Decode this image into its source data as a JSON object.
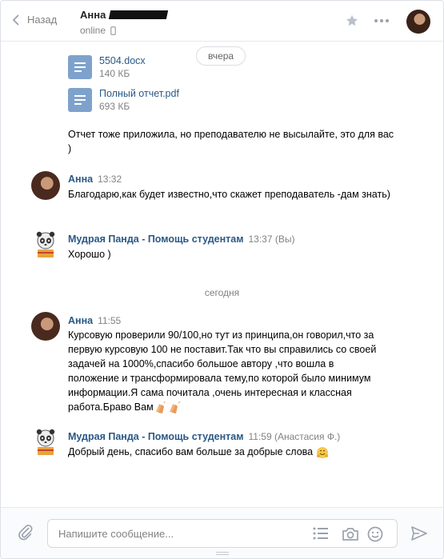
{
  "header": {
    "back_label": "Назад",
    "peer_name": "Анна",
    "peer_status": "online"
  },
  "chat": {
    "date_pill": "вчера",
    "files": [
      {
        "name": "5504.docx",
        "size": "140 КБ"
      },
      {
        "name": "Полный отчет.pdf",
        "size": "693 КБ"
      }
    ],
    "message_1": "Отчет тоже приложила, но преподавателю не высылайте, это для вас )",
    "msg_anna_1": {
      "author": "Анна",
      "time": "13:32",
      "text": "Благодарю,как будет известно,что скажет преподаватель -дам знать)"
    },
    "msg_panda_1": {
      "author": "Мудрая Панда - Помощь студентам",
      "time": "13:37 (Вы)",
      "text": "Хорошо )"
    },
    "day_today": "сегодня",
    "msg_anna_2": {
      "author": "Анна",
      "time": "11:55",
      "text": "Курсовую проверили 90/100,но тут из принципа,он говорил,что за первую курсовую 100 не поставит.Так что вы справились со своей задачей на 1000%,спасибо большое автору ,что вошла в положение и трансформировала тему,по которой было минимум информации.Я сама почитала ,очень интересная и классная работа.Браво Вам"
    },
    "msg_panda_2": {
      "author": "Мудрая Панда - Помощь студентам",
      "time": "11:59 (Анастасия Ф.)",
      "text": "Добрый день, спасибо вам больше за добрые слова"
    }
  },
  "composer": {
    "placeholder": "Напишите сообщение..."
  }
}
